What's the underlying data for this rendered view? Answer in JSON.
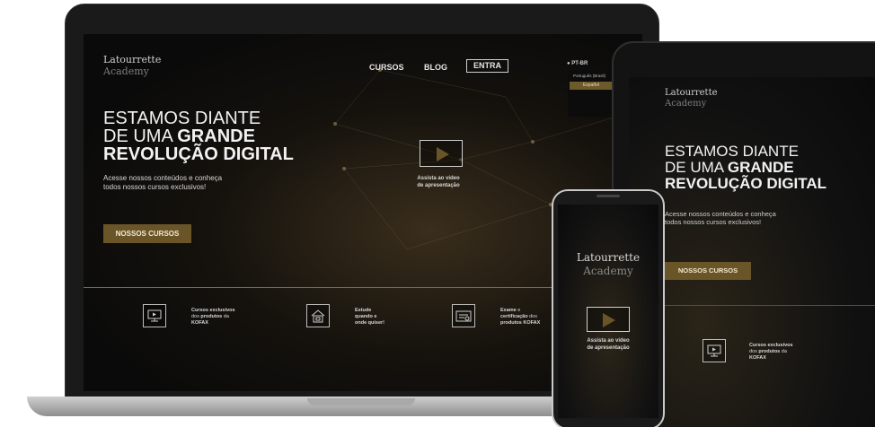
{
  "brand": {
    "line1": "Latourrette",
    "line2": "Academy",
    "accent": "#6a5529"
  },
  "laptop": {
    "nav": {
      "cursos": "CURSOS",
      "blog": "BLOG",
      "entra": "ENTRA"
    },
    "language": {
      "current": "PT-BR",
      "options": [
        "Português (Brasil)"
      ],
      "selected": "Español"
    },
    "hero": {
      "title_line1": "ESTAMOS DIANTE",
      "title_line2_regular": "DE UMA ",
      "title_line2_bold": "GRANDE",
      "title_line3": "REVOLUÇÃO DIGITAL",
      "subtitle_line1": "Acesse nossos conteúdos e conheça",
      "subtitle_line2": "todos nossos cursos exclusivos!",
      "cta": "NOSSOS CURSOS"
    },
    "video": {
      "caption_line1": "Assista ao vídeo",
      "caption_line2": "de apresentação"
    },
    "features": [
      {
        "icon": "monitor-play-icon",
        "l1_b": "Cursos exclusivos",
        "l2_pre": "dos ",
        "l2_b": "produtos",
        "l2_post": " da",
        "l3_b": "KOFAX"
      },
      {
        "icon": "house-laptop-icon",
        "l1_b": "Estude",
        "l2_b": "quando e",
        "l3_b": "onde quiser!"
      },
      {
        "icon": "certificate-icon",
        "l1_b": "Exame",
        "l1_post": " e",
        "l2_b": "certificação",
        "l2_post": " dos",
        "l3_b": "produtos KOFAX"
      }
    ]
  },
  "tablet": {
    "title_line1": "ESTAMOS DIANTE",
    "title_line2_regular": "DE UMA ",
    "title_line2_bold": "GRANDE",
    "title_line3": "REVOLUÇÃO DIGITAL",
    "subtitle_line1": "Acesse nossos conteúdos e conheça",
    "subtitle_line2": "todos nossos cursos exclusivos!",
    "cta": "NOSSOS CURSOS",
    "feature": {
      "l1_b": "Cursos exclusivos",
      "l2_pre": "dos ",
      "l2_b": "produtos",
      "l2_post": " da",
      "l3_b": "KOFAX"
    }
  },
  "phone": {
    "video_caption_line1": "Assista ao vídeo",
    "video_caption_line2": "de apresentação"
  }
}
